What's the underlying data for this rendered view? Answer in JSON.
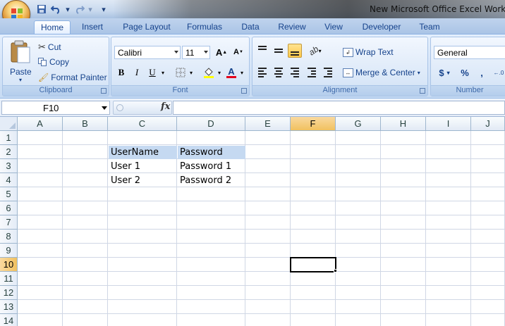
{
  "window": {
    "title": "New Microsoft Office Excel Workshe"
  },
  "qat": {
    "save": "save-icon",
    "undo": "undo-icon",
    "redo": "redo-icon",
    "customize": "customize-qat-icon"
  },
  "tabs": [
    {
      "label": "Home"
    },
    {
      "label": "Insert"
    },
    {
      "label": "Page Layout"
    },
    {
      "label": "Formulas"
    },
    {
      "label": "Data"
    },
    {
      "label": "Review"
    },
    {
      "label": "View"
    },
    {
      "label": "Developer"
    },
    {
      "label": "Team"
    }
  ],
  "ribbon": {
    "clipboard": {
      "label": "Clipboard",
      "paste": "Paste",
      "cut": "Cut",
      "copy": "Copy",
      "format_painter": "Format Painter"
    },
    "font": {
      "label": "Font",
      "name": "Calibri",
      "size": "11",
      "bold": "B",
      "italic": "I",
      "underline": "U",
      "grow": "A",
      "shrink": "A",
      "color": "A"
    },
    "alignment": {
      "label": "Alignment",
      "wrap": "Wrap Text",
      "merge": "Merge & Center"
    },
    "number": {
      "label": "Number",
      "format": "General",
      "currency": "$",
      "percent": "%",
      "comma": ","
    }
  },
  "formula_bar": {
    "name_box": "F10",
    "fx": "fx",
    "value": ""
  },
  "sheet": {
    "columns": [
      "A",
      "B",
      "C",
      "D",
      "E",
      "F",
      "G",
      "H",
      "I",
      "J"
    ],
    "rows": [
      "1",
      "2",
      "3",
      "4",
      "5",
      "6",
      "7",
      "8",
      "9",
      "10",
      "11",
      "12",
      "13",
      "14"
    ],
    "selected_column": "F",
    "selected_row": "10",
    "cells": {
      "C2": "UserName",
      "D2": "Password",
      "C3": "User 1",
      "D3": "Password 1",
      "C4": "User 2",
      "D4": "Password 2"
    }
  },
  "colors": {
    "header_fill": "#c5d9f1",
    "selected_header": "#f1c15f",
    "ribbon_text": "#15428b"
  }
}
